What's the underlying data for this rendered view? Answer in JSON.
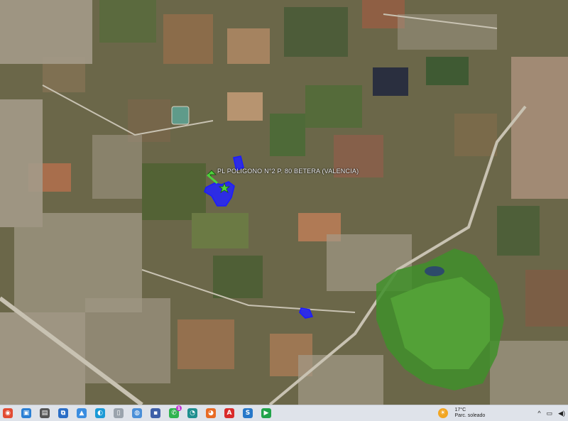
{
  "map": {
    "placemark_label": "PL POLIGONO N°2 P. 80 BETERA (VALENCIA)",
    "colors": {
      "parcel_fill": "#2222ff",
      "parcel_stroke": "#1a1aff",
      "arrow": "#4fd13c",
      "golf": "#3f8f2a",
      "urban": "#a79f90",
      "fields": "#6d6a48"
    },
    "icons": [
      "placemark-arrow-icon",
      "placemark-star-icon"
    ]
  },
  "taskbar": {
    "apps": [
      {
        "name": "chrome-icon",
        "color": "#e24b33",
        "glyph": "◉"
      },
      {
        "name": "monitor-icon",
        "color": "#2a7fd4",
        "glyph": "▣"
      },
      {
        "name": "printer-icon",
        "color": "#555555",
        "glyph": "▤"
      },
      {
        "name": "network-icon",
        "color": "#2b6ec6",
        "glyph": "⧉"
      },
      {
        "name": "photos-icon",
        "color": "#3b8de0",
        "glyph": "▲"
      },
      {
        "name": "edge-icon",
        "color": "#1b9ad6",
        "glyph": "◐"
      },
      {
        "name": "file-icon",
        "color": "#9aa3ad",
        "glyph": "▯"
      },
      {
        "name": "earth-icon",
        "color": "#4a8fd8",
        "glyph": "◍"
      },
      {
        "name": "save-icon",
        "color": "#3d5fa8",
        "glyph": "▪"
      },
      {
        "name": "whatsapp-icon",
        "color": "#2fb34f",
        "glyph": "✆",
        "badge": "1"
      },
      {
        "name": "browser-icon",
        "color": "#1f8f8f",
        "glyph": "◔"
      },
      {
        "name": "firefox-icon",
        "color": "#e86b25",
        "glyph": "◕"
      },
      {
        "name": "acrobat-icon",
        "color": "#d92b2b",
        "glyph": "A"
      },
      {
        "name": "app-s-icon",
        "color": "#2778c9",
        "glyph": "S"
      },
      {
        "name": "app-player-icon",
        "color": "#21a34a",
        "glyph": "▶"
      }
    ],
    "weather": {
      "temp": "17°C",
      "desc": "Parc. soleado"
    },
    "tray_icons": [
      "chevron-up-icon",
      "network-tray-icon",
      "volume-icon"
    ]
  }
}
